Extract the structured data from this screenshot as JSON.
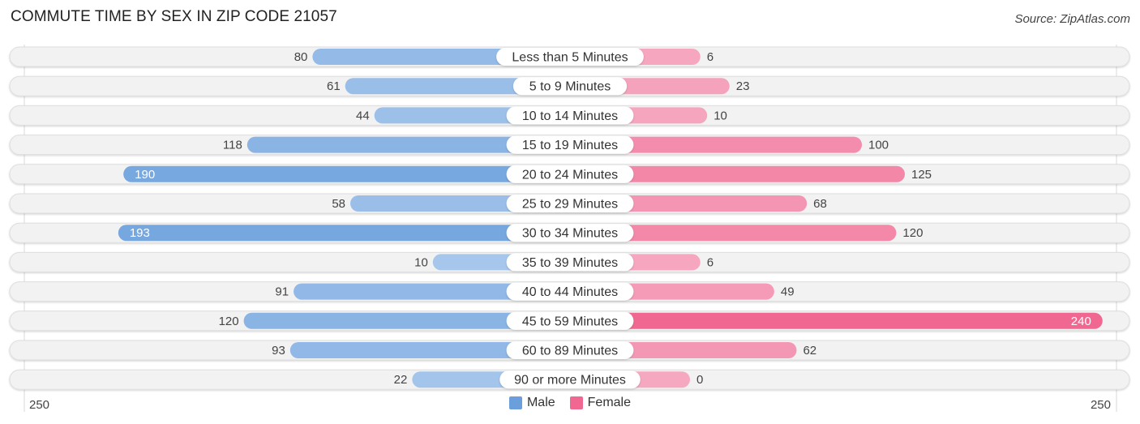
{
  "header": {
    "title": "COMMUTE TIME BY SEX IN ZIP CODE 21057",
    "source": "Source: ZipAtlas.com"
  },
  "colors": {
    "male": "#6a9fdc",
    "male_light": "#a9c8ec",
    "female": "#f06892",
    "female_light": "#f6a8c0",
    "row_bg": "#f2f2f2"
  },
  "chart_data": {
    "type": "bar",
    "orientation": "horizontal-diverging",
    "title": "COMMUTE TIME BY SEX IN ZIP CODE 21057",
    "categories": [
      "Less than 5 Minutes",
      "5 to 9 Minutes",
      "10 to 14 Minutes",
      "15 to 19 Minutes",
      "20 to 24 Minutes",
      "25 to 29 Minutes",
      "30 to 34 Minutes",
      "35 to 39 Minutes",
      "40 to 44 Minutes",
      "45 to 59 Minutes",
      "60 to 89 Minutes",
      "90 or more Minutes"
    ],
    "series": [
      {
        "name": "Male",
        "values": [
          80,
          61,
          44,
          118,
          190,
          58,
          193,
          10,
          91,
          120,
          93,
          22
        ]
      },
      {
        "name": "Female",
        "values": [
          6,
          23,
          10,
          100,
          125,
          68,
          120,
          6,
          49,
          240,
          62,
          0
        ]
      }
    ],
    "axis": {
      "left_label": "250",
      "right_label": "250",
      "max": 250
    },
    "legend": {
      "position": "bottom-center",
      "items": [
        "Male",
        "Female"
      ]
    }
  }
}
